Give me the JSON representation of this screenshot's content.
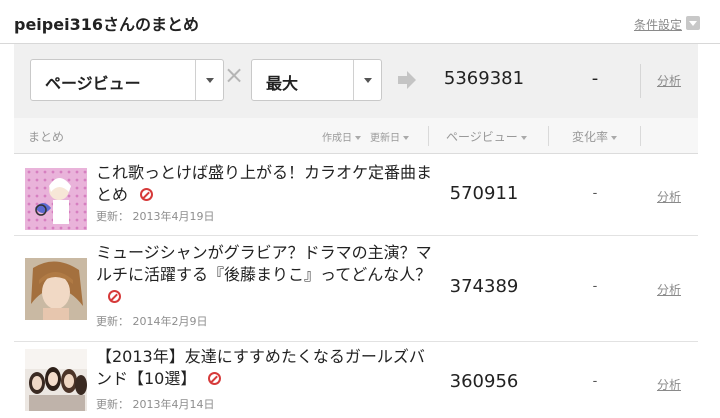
{
  "header": {
    "title": "peipei316さんのまとめ",
    "condition_link": "条件設定"
  },
  "controls": {
    "metric_select": "ページビュー",
    "range_select": "最大",
    "total_pageviews": "5369381",
    "total_change": "-",
    "analyze_label": "分析"
  },
  "columns": {
    "summary": "まとめ",
    "created": "作成日",
    "updated": "更新日",
    "pageviews": "ページビュー",
    "change_rate": "変化率"
  },
  "rows": [
    {
      "title": "これ歌っとけば盛り上がる！カラオケ定番曲まとめ",
      "updated": "更新： 2013年4月19日",
      "pageviews": "570911",
      "change": "-",
      "analyze": "分析"
    },
    {
      "title": "ミュージシャンがグラビア？ドラマの主演？マルチに活躍する『後藤まりこ』ってどんな人？",
      "updated": "更新： 2014年2月9日",
      "pageviews": "374389",
      "change": "-",
      "analyze": "分析"
    },
    {
      "title": "【2013年】友達にすすめたくなるガールズバンド【10選】",
      "updated": "更新： 2013年4月14日",
      "pageviews": "360956",
      "change": "-",
      "analyze": "分析"
    }
  ],
  "icons": {
    "times": "times-icon",
    "arrow": "arrow-right-icon",
    "unpublished": "ban-icon"
  },
  "colors": {
    "link_gray": "#8a8a8a",
    "panel_bg": "#f0f0f0",
    "ban_red": "#d63a3a"
  }
}
